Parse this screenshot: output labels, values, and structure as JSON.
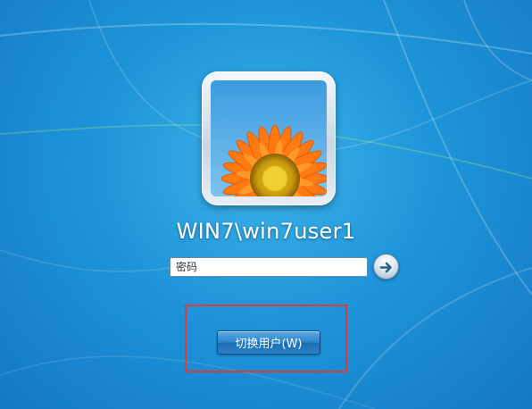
{
  "login": {
    "username": "WIN7\\win7user1",
    "password_placeholder": "密码",
    "password_value": "",
    "switch_user_label": "切换用户(W)"
  },
  "icons": {
    "submit": "arrow-right-icon",
    "avatar": "flower-avatar"
  },
  "colors": {
    "background": "#1e95d9",
    "highlight_border": "#e0393c",
    "button": "#2f86cc"
  }
}
